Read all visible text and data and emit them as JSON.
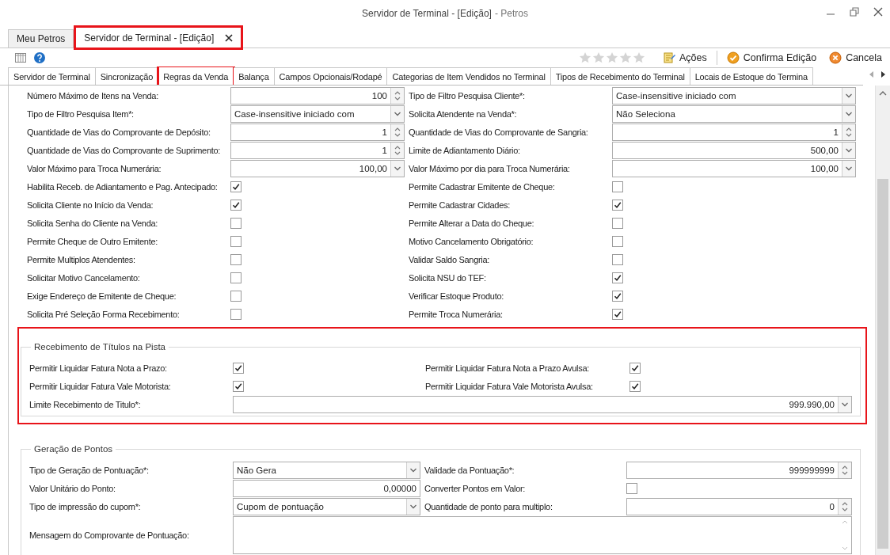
{
  "window": {
    "title": "Servidor de Terminal - [Edição]",
    "app_suffix": "- Petros"
  },
  "doc_tabs": [
    {
      "label": "Meu Petros",
      "selected": false,
      "closable": false,
      "highlighted": false
    },
    {
      "label": "Servidor de Terminal - [Edição]",
      "selected": true,
      "closable": true,
      "highlighted": true
    }
  ],
  "toolbar": {
    "stars": 0,
    "actions": [
      {
        "kind": "actions",
        "label": "Ações"
      },
      {
        "kind": "confirm",
        "label": "Confirma Edição"
      },
      {
        "kind": "cancel",
        "label": "Cancela"
      }
    ]
  },
  "tabs": [
    {
      "label": "Servidor de Terminal",
      "selected": false,
      "highlighted": false
    },
    {
      "label": "Sincronização",
      "selected": false,
      "highlighted": false
    },
    {
      "label": "Regras da Venda",
      "selected": true,
      "highlighted": true
    },
    {
      "label": "Balança",
      "selected": false,
      "highlighted": false
    },
    {
      "label": "Campos Opcionais/Rodapé",
      "selected": false,
      "highlighted": false
    },
    {
      "label": "Categorias de Item Vendidos no Terminal",
      "selected": false,
      "highlighted": false
    },
    {
      "label": "Tipos de Recebimento do Terminal",
      "selected": false,
      "highlighted": false
    },
    {
      "label": "Locais de Estoque do Termina",
      "selected": false,
      "highlighted": false
    }
  ],
  "form": {
    "fields": [
      {
        "label": "Número Máximo de Itens na Venda:",
        "kind": "spin",
        "value": "100"
      },
      {
        "label": "Tipo de Filtro Pesquisa Cliente*:",
        "kind": "combo",
        "value": "Case-insensitive iniciado com"
      },
      {
        "label": "Tipo de Filtro Pesquisa Item*:",
        "kind": "combo",
        "value": "Case-insensitive iniciado com"
      },
      {
        "label": "Solicita Atendente na Venda*:",
        "kind": "combo",
        "value": "Não Seleciona"
      },
      {
        "label": "Quantidade de Vias do Comprovante de Depósito:",
        "kind": "spin",
        "value": "1"
      },
      {
        "label": "Quantidade de Vias do Comprovante de Sangria:",
        "kind": "spin",
        "value": "1"
      },
      {
        "label": "Quantidade de Vias do Comprovante de Suprimento:",
        "kind": "spin",
        "value": "1"
      },
      {
        "label": "Limite de Adiantamento Diário:",
        "kind": "amount",
        "value": "500,00"
      },
      {
        "label": "Valor Máximo para Troca Numerária:",
        "kind": "amount",
        "value": "100,00"
      },
      {
        "label": "Valor Máximo por dia para Troca Numerária:",
        "kind": "amount",
        "value": "100,00"
      },
      {
        "label": "Habilita Receb. de Adiantamento e Pag. Antecipado:",
        "kind": "checkbox",
        "checked": true
      },
      {
        "label": "Permite Cadastrar Emitente de Cheque:",
        "kind": "checkbox",
        "checked": false
      },
      {
        "label": "Solicita Cliente no Início da Venda:",
        "kind": "checkbox",
        "checked": true
      },
      {
        "label": "Permite Cadastrar Cidades:",
        "kind": "checkbox",
        "checked": true
      },
      {
        "label": "Solicita Senha do Cliente na Venda:",
        "kind": "checkbox",
        "checked": false
      },
      {
        "label": "Permite Alterar a Data do Cheque:",
        "kind": "checkbox",
        "checked": false
      },
      {
        "label": "Permite Cheque de Outro Emitente:",
        "kind": "checkbox",
        "checked": false
      },
      {
        "label": "Motivo Cancelamento Obrigatório:",
        "kind": "checkbox",
        "checked": false
      },
      {
        "label": "Permite Multiplos Atendentes:",
        "kind": "checkbox",
        "checked": false
      },
      {
        "label": "Validar Saldo Sangria:",
        "kind": "checkbox",
        "checked": false
      },
      {
        "label": "Solicitar Motivo Cancelamento:",
        "kind": "checkbox",
        "checked": false
      },
      {
        "label": "Solicita NSU do TEF:",
        "kind": "checkbox",
        "checked": true
      },
      {
        "label": "Exige Endereço de Emitente de Cheque:",
        "kind": "checkbox",
        "checked": false
      },
      {
        "label": "Verificar Estoque Produto:",
        "kind": "checkbox",
        "checked": true
      },
      {
        "label": "Solicita Pré Seleção Forma Recebimento:",
        "kind": "checkbox",
        "checked": false
      },
      {
        "label": "Permite Troca Numerária:",
        "kind": "checkbox",
        "checked": true
      }
    ]
  },
  "groups": [
    {
      "title": "Recebimento de Títulos na Pista",
      "highlighted": true,
      "fields": [
        {
          "label": "Permitir Liquidar Fatura Nota a Prazo:",
          "kind": "checkbox",
          "checked": true
        },
        {
          "label": "Permitir Liquidar Fatura Nota a Prazo Avulsa:",
          "kind": "checkbox",
          "checked": true
        },
        {
          "label": "Permitir Liquidar Fatura Vale Motorista:",
          "kind": "checkbox",
          "checked": true
        },
        {
          "label": "Permitir Liquidar Fatura Vale Motorista Avulsa:",
          "kind": "checkbox",
          "checked": true
        },
        {
          "label": "Limite Recebimento de Titulo*:",
          "kind": "amount",
          "value": "999.990,00",
          "wide": true
        }
      ]
    },
    {
      "title": "Geração de Pontos",
      "highlighted": false,
      "fields": [
        {
          "label": "Tipo de Geração de Pontuação*:",
          "kind": "combo",
          "value": "Não Gera"
        },
        {
          "label": "Validade da Pontuação*:",
          "kind": "spin",
          "value": "999999999"
        },
        {
          "label": "Valor Unitário do Ponto:",
          "kind": "number",
          "value": "0,00000"
        },
        {
          "label": "Converter Pontos em Valor:",
          "kind": "checkbox",
          "checked": false
        },
        {
          "label": "Tipo de impressão do cupom*:",
          "kind": "combo",
          "value": "Cupom de pontuação"
        },
        {
          "label": "Quantidade de ponto para multiplo:",
          "kind": "spin",
          "value": "0"
        },
        {
          "label": "Mensagem do Comprovante de Pontuação:",
          "kind": "memo",
          "wide": true
        }
      ]
    }
  ]
}
